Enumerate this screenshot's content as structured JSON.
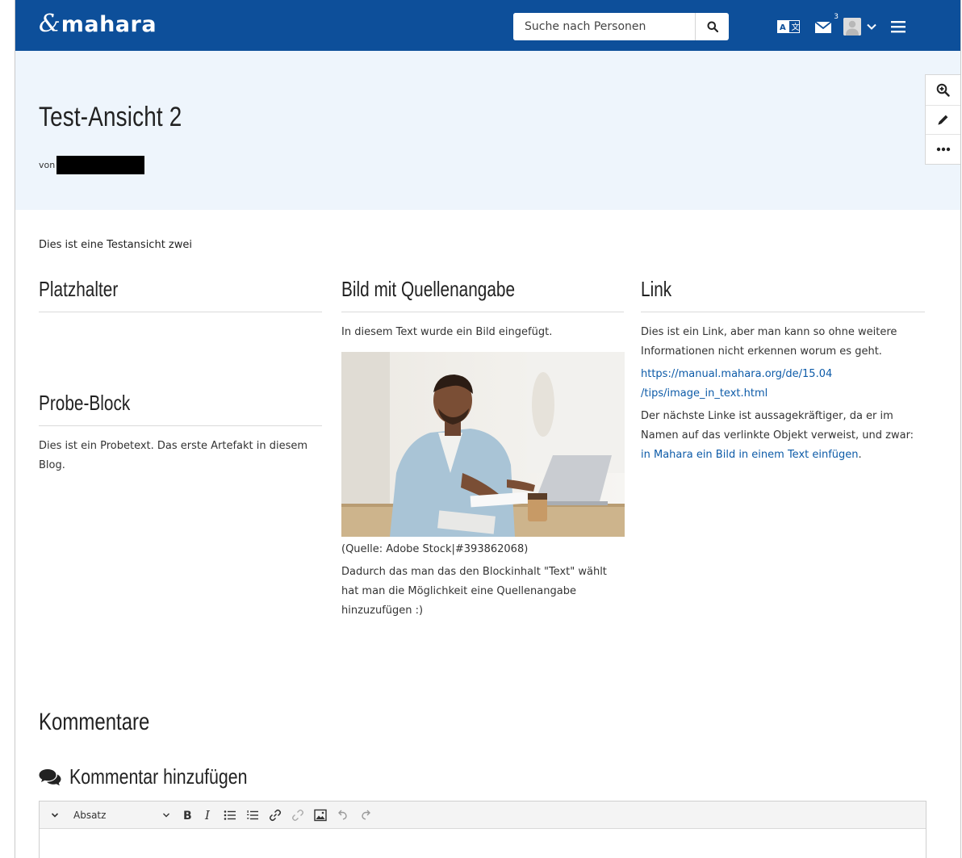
{
  "header": {
    "brand": "mahara",
    "brand_mark": "&",
    "search_placeholder": "Suche nach Personen",
    "mail_count": "3",
    "icons": [
      "search-icon",
      "language-icon",
      "mail-icon",
      "avatar",
      "chevron-down-icon",
      "menu-icon"
    ]
  },
  "page": {
    "title": "Test-Ansicht 2",
    "author_prefix": "von",
    "side_tools": [
      "zoom-in-icon",
      "edit-pencil-icon",
      "more-icon"
    ]
  },
  "intro": "Dies ist eine Testansicht zwei",
  "blocks": {
    "platzhalter": {
      "title": "Platzhalter"
    },
    "probe": {
      "title": "Probe-Block",
      "text": "Dies ist ein Probetext. Das erste Artefakt in diesem Blog."
    },
    "bild": {
      "title": "Bild mit Quellenangabe",
      "text_before": "In diesem Text wurde ein Bild eingefügt.",
      "source": "(Quelle: Adobe Stock|#393862068)",
      "text_after": "Dadurch das man das den Blockinhalt \"Text\" wählt hat man die Möglichkeit eine Quellenangabe hinzuzufügen :)"
    },
    "link": {
      "title": "Link",
      "text1": "Dies ist ein Link, aber man kann so ohne weitere Informationen nicht erkennen worum es geht.",
      "url_line1": "https://manual.mahara.org/de/15.04",
      "url_line2": "/tips/image_in_text.html",
      "text2": "Der nächste Linke ist aussagekräftiger, da er im Namen auf das verlinkte Objekt verweist, und zwar: ",
      "link_text": "in Mahara ein Bild in einem Text einfügen",
      "text2_end": "."
    }
  },
  "comments": {
    "title": "Kommentare",
    "add_label": "Kommentar hinzufügen",
    "editor_format": "Absatz"
  },
  "colors": {
    "header_bg": "#0d4f9a",
    "hero_bg": "#eef5fc",
    "link": "#0d5ba8"
  }
}
